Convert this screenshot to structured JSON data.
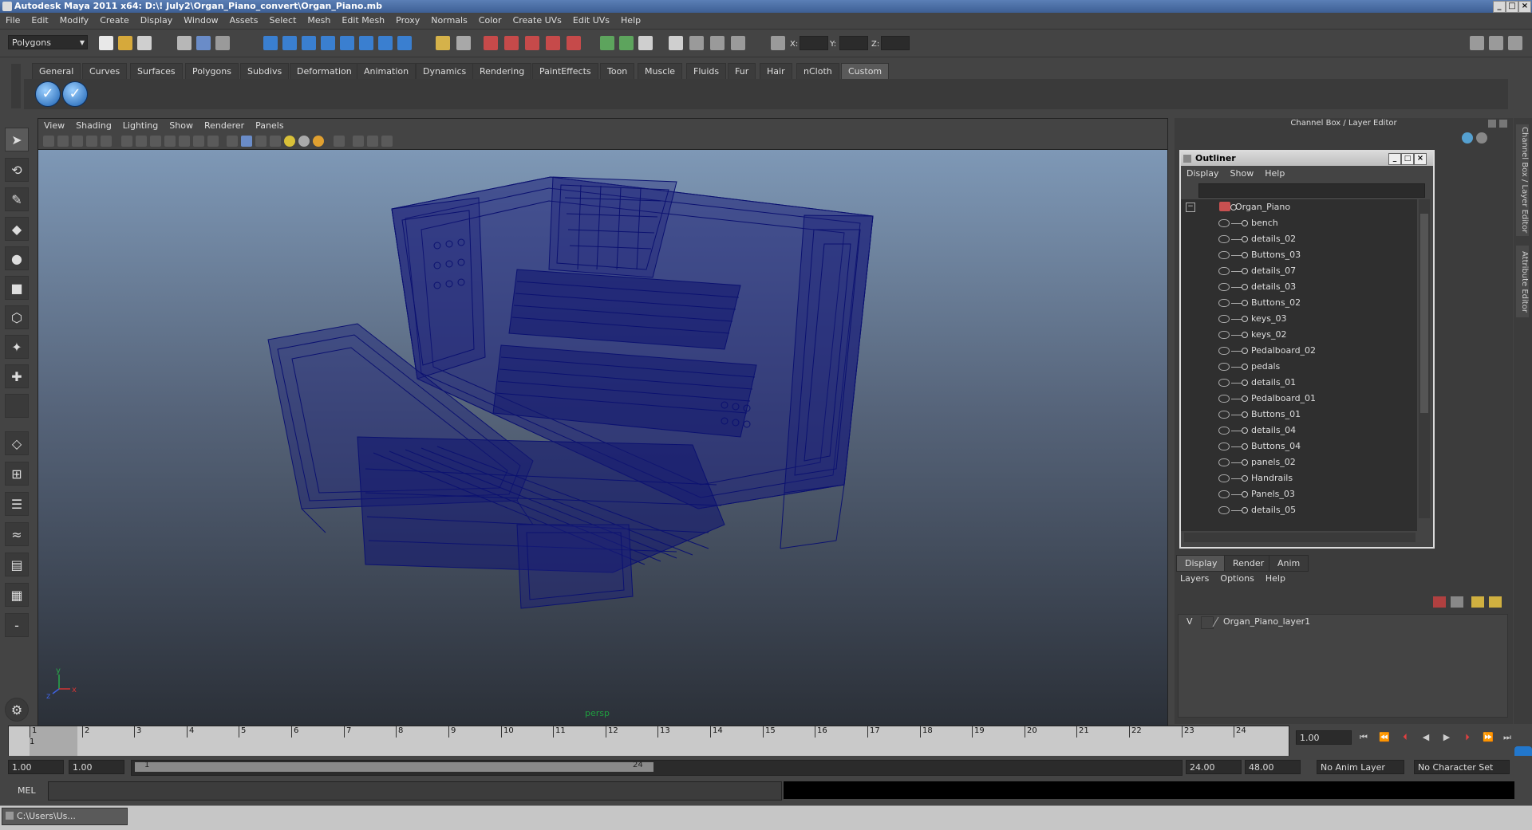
{
  "window": {
    "title": "Autodesk Maya 2011 x64: D:\\! July2\\Organ_Piano_convert\\Organ_Piano.mb"
  },
  "menubar": [
    "File",
    "Edit",
    "Modify",
    "Create",
    "Display",
    "Window",
    "Assets",
    "Select",
    "Mesh",
    "Edit Mesh",
    "Proxy",
    "Normals",
    "Color",
    "Create UVs",
    "Edit UVs",
    "Help"
  ],
  "statusline": {
    "mode": "Polygons",
    "x_label": "X:",
    "y_label": "Y:",
    "z_label": "Z:"
  },
  "shelf": {
    "tabs": [
      "General",
      "Curves",
      "Surfaces",
      "Polygons",
      "Subdivs",
      "Deformation",
      "Animation",
      "Dynamics",
      "Rendering",
      "PaintEffects",
      "Toon",
      "Muscle",
      "Fluids",
      "Fur",
      "Hair",
      "nCloth",
      "Custom"
    ],
    "active_tab": "Custom"
  },
  "viewport": {
    "menu": [
      "View",
      "Shading",
      "Lighting",
      "Show",
      "Renderer",
      "Panels"
    ],
    "camera_label": "persp",
    "axis_y": "y",
    "axis_x": "x",
    "axis_z": "z"
  },
  "dock": {
    "header": "Channel Box / Layer Editor"
  },
  "outliner": {
    "title": "Outliner",
    "menu": [
      "Display",
      "Show",
      "Help"
    ],
    "root": "Organ_Piano",
    "items": [
      "bench",
      "details_02",
      "Buttons_03",
      "details_07",
      "details_03",
      "Buttons_02",
      "keys_03",
      "keys_02",
      "Pedalboard_02",
      "pedals",
      "details_01",
      "Pedalboard_01",
      "Buttons_01",
      "details_04",
      "Buttons_04",
      "panels_02",
      "Handrails",
      "Panels_03",
      "details_05"
    ]
  },
  "layer_editor": {
    "tabs": [
      "Display",
      "Render",
      "Anim"
    ],
    "active_tab": "Display",
    "menu": [
      "Layers",
      "Options",
      "Help"
    ],
    "layer_visible": "V",
    "layer_name": "Organ_Piano_layer1"
  },
  "side_tabs": [
    "Channel Box / Layer Editor",
    "Attribute Editor"
  ],
  "timeline": {
    "ticks": [
      "1",
      "2",
      "3",
      "4",
      "5",
      "6",
      "7",
      "8",
      "9",
      "10",
      "11",
      "12",
      "13",
      "14",
      "15",
      "16",
      "17",
      "18",
      "19",
      "20",
      "21",
      "22",
      "23",
      "24"
    ],
    "current_frame": "1.00",
    "marker": "1"
  },
  "range": {
    "start": "1.00",
    "playback_start": "1.00",
    "handle_start": "1",
    "handle_end": "24",
    "playback_end": "24.00",
    "end": "48.00",
    "anim_layer": "No Anim Layer",
    "character_set": "No Character Set"
  },
  "command": {
    "label": "MEL"
  },
  "taskbar": {
    "item": "C:\\Users\\Us..."
  },
  "colors": {
    "wire": "#0b1170",
    "accent_green": "#1f9e3f"
  }
}
